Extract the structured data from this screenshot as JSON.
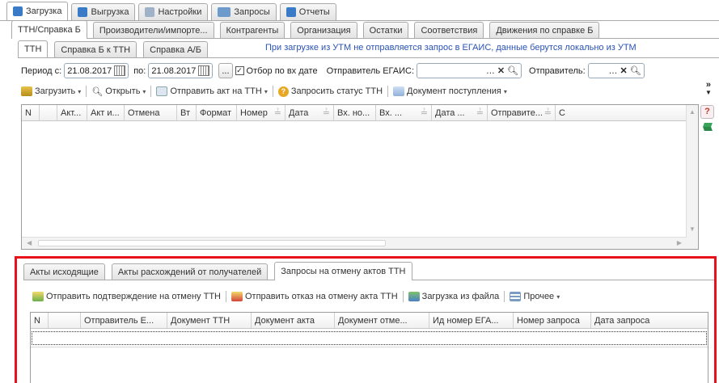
{
  "top_tabs": [
    {
      "label": "Загрузка",
      "icon": "upload-icon",
      "color": "#3a7bc8"
    },
    {
      "label": "Выгрузка",
      "icon": "download-icon",
      "color": "#3a7bc8"
    },
    {
      "label": "Настройки",
      "icon": "settings-icon",
      "color": "#7a8fa8"
    },
    {
      "label": "Запросы",
      "icon": "queries-icon",
      "color": "#5c8ec0"
    },
    {
      "label": "Отчеты",
      "icon": "reports-icon",
      "color": "#3a7bc8"
    }
  ],
  "sub_tabs": [
    "ТТН/Справка Б",
    "Производители/импорте...",
    "Контрагенты",
    "Организация",
    "Остатки",
    "Соответствия",
    "Движения по справке Б"
  ],
  "doc_tabs": [
    "ТТН",
    "Справка Б к ТТН",
    "Справка А/Б"
  ],
  "info_text": "При загрузке из УТМ не отправляется запрос в ЕГАИС, данные берутся локально из УТМ",
  "filter": {
    "period_label": "Период с:",
    "date_from": "21.08.2017",
    "to_label": "по:",
    "date_to": "21.08.2017",
    "ellipsis": "...",
    "checkbox_label": "Отбор по вх дате",
    "sender_egais_label": "Отправитель ЕГАИС:",
    "sender_label": "Отправитель:"
  },
  "toolbar1": {
    "load": "Загрузить",
    "open": "Открыть",
    "send_act": "Отправить акт на ТТН",
    "request_status": "Запросить статус ТТН",
    "receipt_doc": "Документ поступления",
    "more": "»"
  },
  "grid1_columns": [
    "N",
    "",
    "Акт...",
    "Акт и...",
    "Отмена",
    "Вт",
    "Формат",
    "Номер",
    "Дата",
    "Вх. но...",
    "Вх. ...",
    "Дата ...",
    "Отправите...",
    "С"
  ],
  "bottom_tabs": [
    "Акты исходящие",
    "Акты расхождений от получателей",
    "Запросы на отмену актов ТТН"
  ],
  "toolbar2": {
    "send_confirm": "Отправить подтверждение на отмену ТТН",
    "send_reject": "Отправить отказ на отмену акта ТТН",
    "load_file": "Загрузка из файла",
    "other": "Прочее"
  },
  "grid2_columns": [
    "N",
    "",
    "Отправитель Е...",
    "Документ ТТН",
    "Документ акта",
    "Документ отме...",
    "Ид номер ЕГА...",
    "Номер запроса",
    "Дата запроса"
  ],
  "colors": {
    "highlight_border": "#e8121b",
    "link_text": "#2b52b5",
    "help_icon": "#c0392b"
  }
}
